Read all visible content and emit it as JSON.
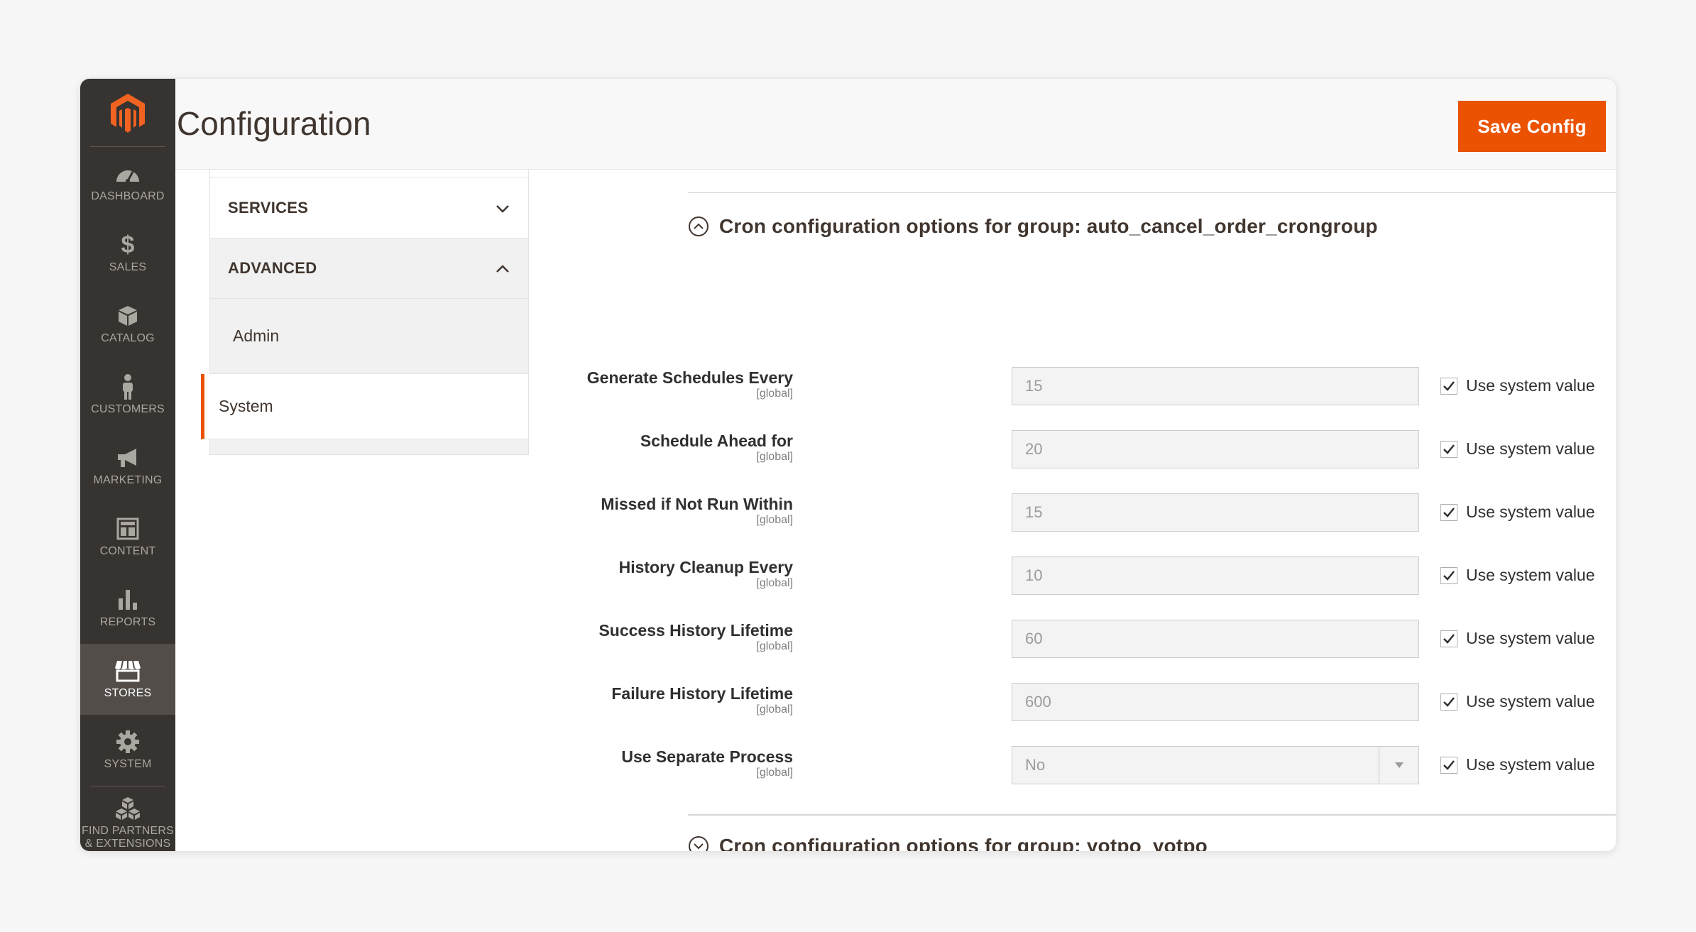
{
  "admin_menu": {
    "items": [
      {
        "label": "DASHBOARD",
        "icon": "dashboard-icon"
      },
      {
        "label": "SALES",
        "icon": "dollar-icon"
      },
      {
        "label": "CATALOG",
        "icon": "box-icon"
      },
      {
        "label": "CUSTOMERS",
        "icon": "person-icon"
      },
      {
        "label": "MARKETING",
        "icon": "megaphone-icon"
      },
      {
        "label": "CONTENT",
        "icon": "layout-icon"
      },
      {
        "label": "REPORTS",
        "icon": "bar-chart-icon"
      },
      {
        "label": "STORES",
        "icon": "storefront-icon",
        "active": true
      },
      {
        "label": "SYSTEM",
        "icon": "gear-icon"
      },
      {
        "label": "FIND PARTNERS & EXTENSIONS",
        "icon": "cubes-icon"
      }
    ]
  },
  "header": {
    "title": "Configuration",
    "save_label": "Save Config"
  },
  "tabs": {
    "services_label": "SERVICES",
    "advanced_label": "ADVANCED",
    "links": [
      "Admin",
      "System"
    ],
    "active_link": "System"
  },
  "groups": [
    {
      "title": "Cron configuration options for group: auto_cancel_order_crongroup",
      "expanded": true
    },
    {
      "title": "Cron configuration options for group: yotpo_yotpo",
      "expanded": false
    }
  ],
  "fields": [
    {
      "label": "Generate Schedules Every",
      "scope": "[global]",
      "value": "15",
      "checkbox_label": "Use system value",
      "checked": true
    },
    {
      "label": "Schedule Ahead for",
      "scope": "[global]",
      "value": "20",
      "checkbox_label": "Use system value",
      "checked": true
    },
    {
      "label": "Missed if Not Run Within",
      "scope": "[global]",
      "value": "15",
      "checkbox_label": "Use system value",
      "checked": true
    },
    {
      "label": "History Cleanup Every",
      "scope": "[global]",
      "value": "10",
      "checkbox_label": "Use system value",
      "checked": true
    },
    {
      "label": "Success History Lifetime",
      "scope": "[global]",
      "value": "60",
      "checkbox_label": "Use system value",
      "checked": true
    },
    {
      "label": "Failure History Lifetime",
      "scope": "[global]",
      "value": "600",
      "checkbox_label": "Use system value",
      "checked": true
    },
    {
      "label": "Use Separate Process",
      "scope": "[global]",
      "value": "No",
      "checkbox_label": "Use system value",
      "checked": true
    }
  ],
  "colors": {
    "accent": "#eb5202",
    "menu_bg": "#373330",
    "menu_active": "#524d49"
  }
}
